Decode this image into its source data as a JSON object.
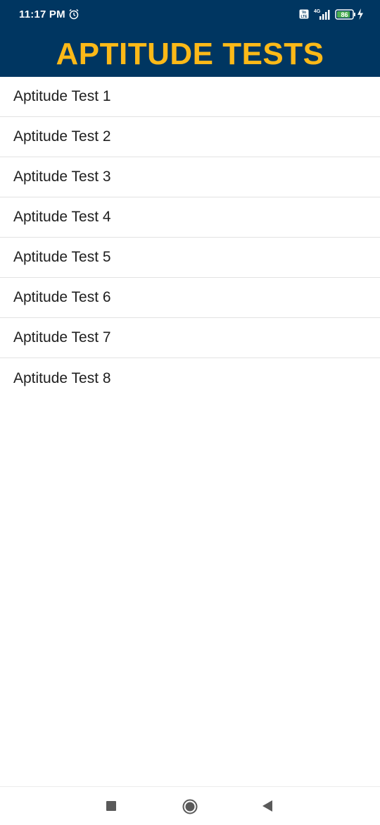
{
  "status_bar": {
    "time": "11:17 PM",
    "volte_label": "Vo LTE",
    "network_label": "4G",
    "battery_level": "86",
    "icons": [
      "alarm-icon",
      "volte-icon",
      "signal-icon",
      "battery-icon",
      "charging-bolt-icon"
    ]
  },
  "header": {
    "title": "APTITUDE TESTS"
  },
  "tests": {
    "items": [
      {
        "label": "Aptitude Test 1"
      },
      {
        "label": "Aptitude Test 2"
      },
      {
        "label": "Aptitude Test 3"
      },
      {
        "label": "Aptitude Test 4"
      },
      {
        "label": "Aptitude Test 5"
      },
      {
        "label": "Aptitude Test 6"
      },
      {
        "label": "Aptitude Test 7"
      },
      {
        "label": "Aptitude Test 8"
      }
    ]
  },
  "nav_bar": {
    "icons": [
      "recent-apps-icon",
      "home-icon",
      "back-icon"
    ]
  },
  "colors": {
    "header_bg": "#003661",
    "title": "#fcb918",
    "battery_fill": "#4caf50"
  }
}
